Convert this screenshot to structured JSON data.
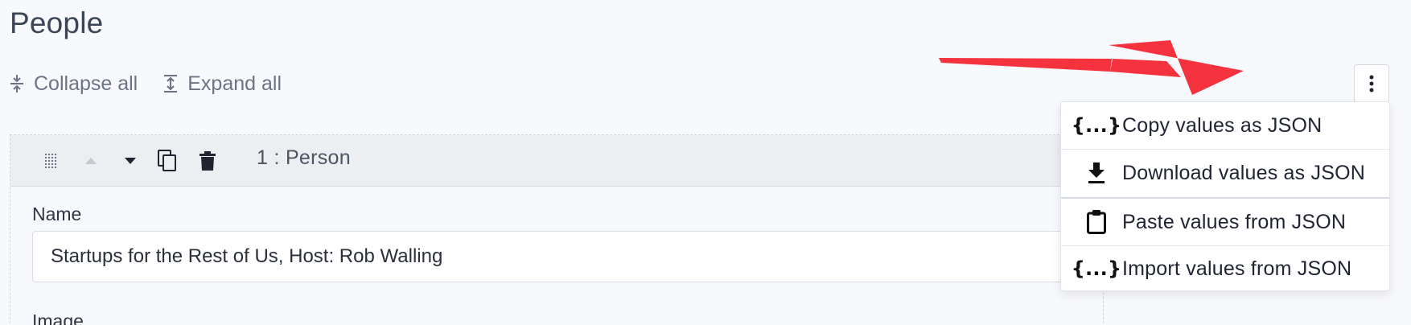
{
  "page": {
    "title": "People"
  },
  "toolbar": {
    "collapse_label": "Collapse all",
    "expand_label": "Expand all"
  },
  "item": {
    "title": "1 : Person",
    "fields": [
      {
        "label": "Name",
        "value": "Startups for the Rest of Us, Host: Rob Walling"
      },
      {
        "label": "Image"
      }
    ]
  },
  "menu": {
    "items": [
      {
        "label": "Copy values as JSON",
        "icon": "braces-icon"
      },
      {
        "label": "Download values as JSON",
        "icon": "download-icon"
      },
      {
        "label": "Paste values from JSON",
        "icon": "clipboard-icon"
      },
      {
        "label": "Import values from JSON",
        "icon": "braces-icon"
      }
    ],
    "brace_glyph": "{...}"
  },
  "colors": {
    "annotation_arrow": "#f5333f",
    "text_muted": "#6b7384"
  }
}
